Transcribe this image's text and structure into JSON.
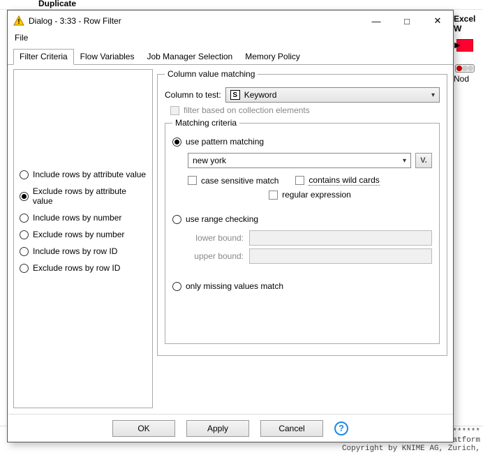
{
  "bg": {
    "duplicate": "Duplicate",
    "excel": "Excel W",
    "nod": "Nod",
    "stars": "********",
    "atform": "atform",
    "copyright": "Copyright by KNIME AG, Zurich,"
  },
  "window": {
    "title": "Dialog - 3:33 - Row Filter",
    "menu_file": "File"
  },
  "tabs": {
    "filter": "Filter Criteria",
    "flow": "Flow Variables",
    "job": "Job Manager Selection",
    "mem": "Memory Policy"
  },
  "left_radios": {
    "r0": "Include rows by attribute value",
    "r1": "Exclude rows by attribute value",
    "r2": "Include rows by number",
    "r3": "Exclude rows by number",
    "r4": "Include rows by row ID",
    "r5": "Exclude rows by row ID"
  },
  "col_match": {
    "legend": "Column value matching",
    "column_label": "Column to test:",
    "column_value": "Keyword",
    "column_badge": "S",
    "filter_collection": "filter based on collection elements"
  },
  "matching": {
    "legend": "Matching criteria",
    "use_pattern": "use pattern matching",
    "pattern_value": "new york",
    "case_sensitive": "case sensitive match",
    "wild": "contains wild cards",
    "regex": "regular expression",
    "use_range": "use range checking",
    "lower": "lower bound:",
    "upper": "upper bound:",
    "only_missing": "only missing values match",
    "vbtn": "V."
  },
  "buttons": {
    "ok": "OK",
    "apply": "Apply",
    "cancel": "Cancel",
    "help": "?"
  }
}
